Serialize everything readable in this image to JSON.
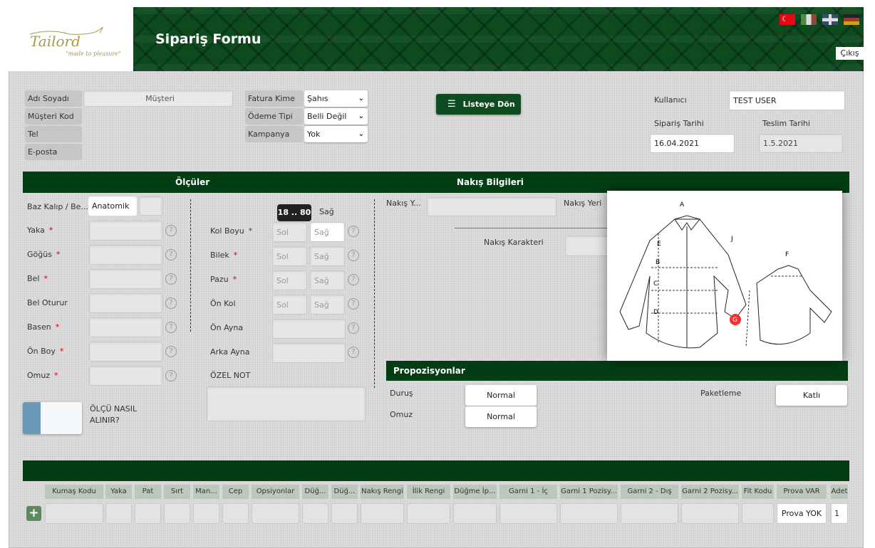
{
  "header": {
    "title": "Sipariş Formu",
    "logo_text": "Tailord",
    "logo_tagline": "\"made to pleasure\"",
    "logout": "Çıkış",
    "flags": [
      {
        "name": "turkish",
        "color": "#e30a17"
      },
      {
        "name": "italian",
        "color": "#009246"
      },
      {
        "name": "english",
        "color": "#012169"
      },
      {
        "name": "german",
        "color": "#000000"
      }
    ]
  },
  "customer": {
    "name_label": "Adı Soyadı",
    "name_value": "Müşteri",
    "code_label": "Müşteri Kod",
    "tel_label": "Tel",
    "email_label": "E-posta"
  },
  "billing": {
    "invoice_label": "Fatura Kime",
    "invoice_value": "Şahıs",
    "payment_label": "Ödeme Tipi",
    "payment_value": "Belli Değil",
    "campaign_label": "Kampanya",
    "campaign_value": "Yok"
  },
  "back_button": "Listeye Dön",
  "user": {
    "user_label": "Kullanıcı",
    "user_value": "TEST USER",
    "order_date_label": "Sipariş Tarihi",
    "order_date": "16.04.2021",
    "delivery_date_label": "Teslim Tarihi",
    "delivery_date": "1.5.2021"
  },
  "measurements": {
    "title": "Ölçüler",
    "base_label": "Baz Kalıp / Be...",
    "base_value": "Anatomik",
    "left": [
      {
        "label": "Yaka",
        "req": "*"
      },
      {
        "label": "Göğüs",
        "req": "*"
      },
      {
        "label": "Bel",
        "req": "*"
      },
      {
        "label": "Bel Oturur",
        "req": ""
      },
      {
        "label": "Basen",
        "req": "*"
      },
      {
        "label": "Ön Boy",
        "req": "*"
      },
      {
        "label": "Omuz",
        "req": "*"
      }
    ],
    "tooltip": "18 .. 80",
    "sag_header": "Sağ",
    "sol_placeholder": "Sol",
    "sag_placeholder": "Sağ",
    "right": [
      {
        "label": "Kol Boyu",
        "req": "*"
      },
      {
        "label": "Bilek",
        "req": "*"
      },
      {
        "label": "Pazu",
        "req": "*"
      },
      {
        "label": "Ön Kol",
        "req": ""
      }
    ],
    "on_ayna": "Ön Ayna",
    "arka_ayna": "Arka Ayna",
    "note_label": "ÖZEL NOT",
    "help_icon": "?",
    "how_to_line1": "ÖLÇÜ NASIL",
    "how_to_line2": "ALINIR?"
  },
  "embroidery": {
    "title": "Nakış Bilgileri",
    "text_label": "Nakış Y...",
    "place_label": "Nakış Yeri",
    "char_label": "Nakış Karakteri"
  },
  "diagram": {
    "labels": [
      "A",
      "B",
      "C",
      "D",
      "E",
      "F",
      "G",
      "J"
    ]
  },
  "proportions": {
    "title": "Propozisyonlar",
    "durus_label": "Duruş",
    "durus_value": "Normal",
    "omuz_label": "Omuz",
    "omuz_value": "Normal",
    "packing_label": "Paketleme",
    "packing_value": "Katlı"
  },
  "fabric_table": {
    "add_icon": "+",
    "columns": [
      "Kumaş Kodu",
      "Yaka",
      "Pat",
      "Sırt",
      "Man...",
      "Cep",
      "Opsiyonlar",
      "Düğ...",
      "Düğ...",
      "Nakış Rengi",
      "İlik Rengi",
      "Düğme İp...",
      "Garni 1 - İç",
      "Garni 1 Pozisy...",
      "Garni 2 - Dış",
      "Garni 2 Pozisy...",
      "Fit Kodu",
      "Prova VAR",
      "Adet"
    ],
    "row": {
      "prova": "Prova YOK",
      "adet": "1"
    }
  }
}
